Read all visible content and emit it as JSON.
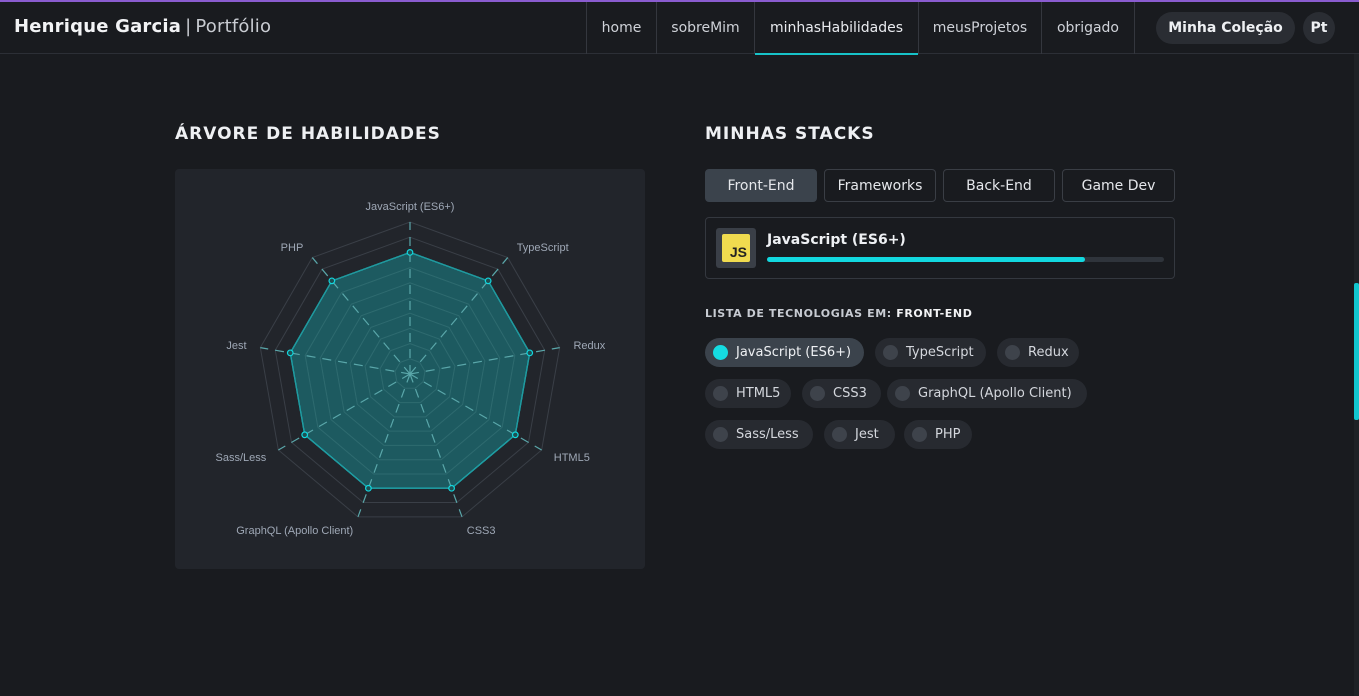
{
  "app": {
    "brand_name": "Henrique Garcia",
    "brand_separator": "|",
    "brand_sub": "Portfólio"
  },
  "nav": {
    "links": [
      "home",
      "sobreMim",
      "minhasHabilidades",
      "meusProjetos",
      "obrigado"
    ],
    "active": "minhasHabilidades",
    "collection_button": "Minha Coleção",
    "language_button": "Pt"
  },
  "skills_tree": {
    "title": "ÁRVORE DE HABILIDADES",
    "labels": [
      "JavaScript (ES6+)",
      "TypeScript",
      "Redux",
      "HTML5",
      "CSS3",
      "GraphQL (Apollo Client)",
      "Sass/Less",
      "Jest",
      "PHP"
    ],
    "values": [
      0.8,
      0.8,
      0.8,
      0.8,
      0.8,
      0.8,
      0.8,
      0.8,
      0.8
    ],
    "colors": {
      "fill": "#12c9cf",
      "stroke": "#12d8df",
      "grid": "#3a3f47",
      "spoke": "#5aa7aa"
    }
  },
  "stacks": {
    "title": "MINHAS STACKS",
    "tabs": [
      "Front-End",
      "Frameworks",
      "Back-End",
      "Game Dev"
    ],
    "active_tab": "Front-End",
    "selected_skill": {
      "name": "JavaScript (ES6+)",
      "icon": "javascript-icon",
      "icon_text": "JS",
      "progress": 0.8
    },
    "list_prefix": "LISTA DE TECNOLOGIAS EM:",
    "list_category": "FRONT-END",
    "technologies": [
      "JavaScript (ES6+)",
      "TypeScript",
      "Redux",
      "HTML5",
      "CSS3",
      "GraphQL (Apollo Client)",
      "Sass/Less",
      "Jest",
      "PHP"
    ],
    "active_technology": "JavaScript (ES6+)"
  },
  "colors": {
    "background": "#191b1f",
    "accent": "#12d8df",
    "card": "#22252b",
    "top_border": "#8a5ccf"
  }
}
